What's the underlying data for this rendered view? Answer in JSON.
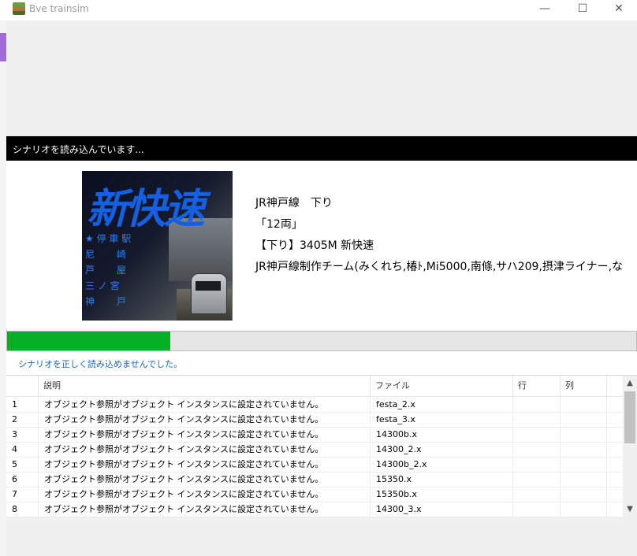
{
  "window": {
    "title": "Bve trainsim",
    "minimize": "—",
    "maximize": "☐",
    "close": "✕"
  },
  "loading": {
    "header": "シナリオを読み込んでいます..."
  },
  "thumbnail": {
    "title": "新快速",
    "stations": [
      "★ 停 車 駅",
      "尼　　 崎",
      "芦　　 屋",
      "三 ノ 宮",
      "神　　 戸"
    ]
  },
  "scenario": {
    "route": "JR神戸線　下り",
    "cars": "「12両」",
    "train": "【下り】3405M 新快速",
    "authors": "JR神戸線制作チーム(みくれち,椿ﾄ,Mi5000,南條,サハ209,摂津ライナー,な"
  },
  "progress": {
    "fraction": 0.26
  },
  "error_message": "シナリオを正しく読み込めませんでした。",
  "table": {
    "columns": [
      "",
      "説明",
      "ファイル",
      "行",
      "列"
    ],
    "rows": [
      {
        "no": "1",
        "desc": "オブジェクト参照がオブジェクト インスタンスに設定されていません。",
        "file": "festa_2.x",
        "line": "",
        "col": ""
      },
      {
        "no": "2",
        "desc": "オブジェクト参照がオブジェクト インスタンスに設定されていません。",
        "file": "festa_3.x",
        "line": "",
        "col": ""
      },
      {
        "no": "3",
        "desc": "オブジェクト参照がオブジェクト インスタンスに設定されていません。",
        "file": "14300b.x",
        "line": "",
        "col": ""
      },
      {
        "no": "4",
        "desc": "オブジェクト参照がオブジェクト インスタンスに設定されていません。",
        "file": "14300_2.x",
        "line": "",
        "col": ""
      },
      {
        "no": "5",
        "desc": "オブジェクト参照がオブジェクト インスタンスに設定されていません。",
        "file": "14300b_2.x",
        "line": "",
        "col": ""
      },
      {
        "no": "6",
        "desc": "オブジェクト参照がオブジェクト インスタンスに設定されていません。",
        "file": "15350.x",
        "line": "",
        "col": ""
      },
      {
        "no": "7",
        "desc": "オブジェクト参照がオブジェクト インスタンスに設定されていません。",
        "file": "15350b.x",
        "line": "",
        "col": ""
      },
      {
        "no": "8",
        "desc": "オブジェクト参照がオブジェクト インスタンスに設定されていません。",
        "file": "14300_3.x",
        "line": "",
        "col": ""
      }
    ]
  },
  "colors": {
    "progress": "#06b025",
    "error_text": "#1a66b8",
    "header_bg": "#000000"
  }
}
